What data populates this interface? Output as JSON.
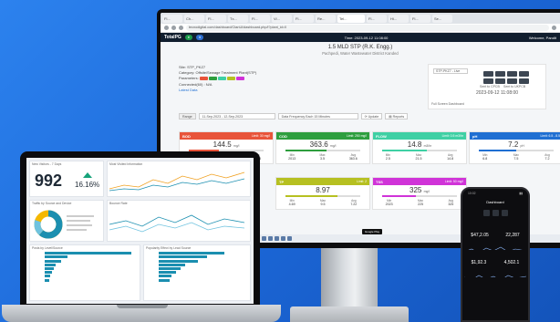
{
  "monitor": {
    "browser_tabs": [
      "Fl...",
      "Ch...",
      "Fl...",
      "Tx...",
      "Fl...",
      "Vi...",
      "Fl...",
      "Re...",
      "Tel...",
      "Fl...",
      "Hi...",
      "Fl...",
      "Se..."
    ],
    "url": "tecnodigital.com/dashboard/CtanUl/dashboard.php/l?plant_id=0",
    "app": {
      "logo": "TotalPG",
      "time": "Time: 2023-09-12 11:08:00",
      "welcome": "Welcome, Pandit"
    },
    "page_title": "1.5 MLD STP (R.K. Engg.)",
    "page_subtitle": "Pachpedi, Water Wastewater District Kanded",
    "site_info": {
      "site": "Site: STP_PKZ7",
      "category": "Category: Offsite/Sewage Treatment Plant(STP)",
      "parameters": "Parameters:",
      "connected": "Connected(60) : N/A",
      "latest": "Latest Data"
    },
    "controls": {
      "station": "STP-PKZ7 - Live",
      "timestamp": "2023-09-12 11:08:00",
      "sent_cpcb": "Sent to CPCB",
      "sent_ukpcb": "Sent to UKPCB",
      "full_screen": "Full Screen Dashboard"
    },
    "filter": {
      "range": "Range",
      "dates": "11-Sep-2023 - 12-Sep-2023",
      "frequency": "Data Frequency Each 15 Minutes",
      "update": "Update",
      "reports": "Reports"
    },
    "cards": [
      {
        "name": "BOD",
        "limit": "Limit: 30 mg/l",
        "value": "144.5",
        "unit": "mg/l",
        "min": "200.0",
        "max": "94.5",
        "avg": "144.5",
        "fill": 0.4,
        "color": "#e8543a"
      },
      {
        "name": "COD",
        "limit": "Limit: 250 mg/l",
        "value": "363.6",
        "unit": "mg/l",
        "min": "2013",
        "max": "3.5",
        "avg": "363.6",
        "fill": 0.55,
        "color": "#2e9e3e"
      },
      {
        "name": "FLOW",
        "limit": "Limit: 0.5 m3/hr",
        "value": "14.8",
        "unit": "m3/hr",
        "min": "2.5",
        "max": "21.5",
        "avg": "14.8",
        "fill": 0.6,
        "color": "#3fd0a4"
      },
      {
        "name": "pH",
        "limit": "Limit: 6.5 - 8.5",
        "value": "7.2",
        "unit": "pH",
        "min": "6.8",
        "max": "7.5",
        "avg": "7.2",
        "fill": 0.5,
        "color": "#1f6fd2"
      },
      {
        "name": "TP",
        "limit": "Limit: 2",
        "value": "8.97",
        "unit": "",
        "min": "4.69",
        "max": "9.5",
        "avg": "7.22",
        "fill": 0.7,
        "color": "#b6c021"
      },
      {
        "name": "TSS",
        "limit": "Limit: 50 mg/l",
        "value": "325",
        "unit": "mg/l",
        "min": "2023",
        "max": "225",
        "avg": "325",
        "fill": 0.45,
        "color": "#d033d8"
      }
    ],
    "google_play": "Google Play"
  },
  "laptop": {
    "kpi_title": "New Visitors - 7 Days",
    "kpi_value": "992",
    "kpi_pct": "16.16%",
    "traffic_title": "Most Visited Information",
    "donut_title": "Traffic by Source and Device",
    "bounce_title": "Bounce Rate",
    "bars1_title": "Posts by Level/Source",
    "bars2_title": "Popularity Effect by Lead Source",
    "bars1": [
      0.95,
      0.25,
      0.18,
      0.12,
      0.1,
      0.08,
      0.06,
      0.05
    ],
    "bars2": [
      0.75,
      0.55,
      0.45,
      0.3,
      0.25,
      0.2,
      0.15,
      0.12
    ]
  },
  "phone": {
    "time": "10:02",
    "title": "Dashboard",
    "v1": "$47,2.05",
    "v2": "22,287",
    "v3": "$1,92.3",
    "v4": "4,502.1"
  }
}
